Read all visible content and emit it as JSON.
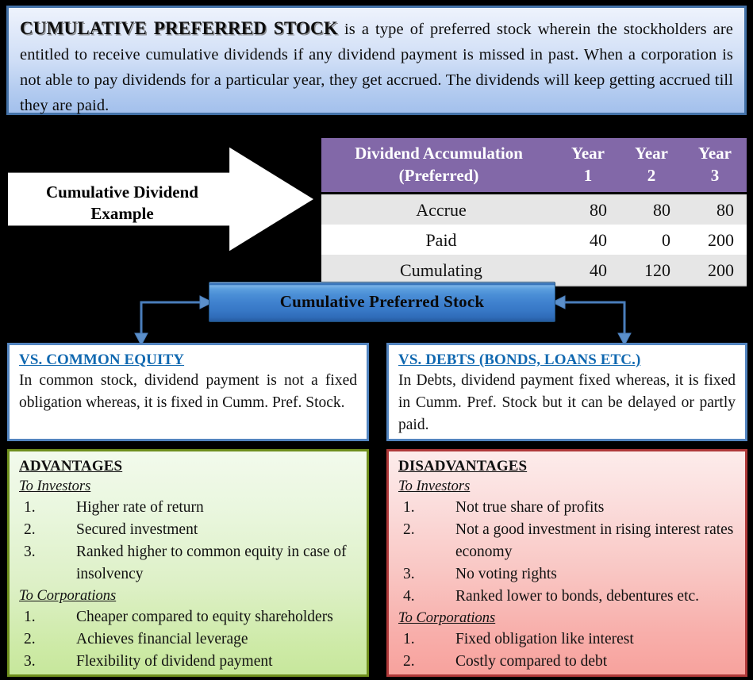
{
  "definition": {
    "lead": "CUMULATIVE PREFERRED STOCK",
    "rest": " is a type of preferred stock wherein the stockholders are entitled to receive cumulative dividends if any dividend payment is missed in past. When a corporation is not able to pay dividends for a particular year, they get accrued. The dividends will keep getting accrued till they are paid."
  },
  "example_arrow": {
    "label": "Cumulative Dividend Example"
  },
  "table": {
    "header_metric_line1": "Dividend Accumulation",
    "header_metric_line2": "(Preferred)",
    "year_word": "Year",
    "year_numbers": [
      "1",
      "2",
      "3"
    ],
    "rows": [
      {
        "metric": "Accrue",
        "values": [
          "80",
          "80",
          "80"
        ]
      },
      {
        "metric": "Paid",
        "values": [
          "40",
          "0",
          "200"
        ]
      },
      {
        "metric": "Cumulating",
        "values": [
          "40",
          "120",
          "200"
        ]
      }
    ]
  },
  "center_banner": {
    "label": "Cumulative Preferred Stock"
  },
  "compare": {
    "left": {
      "title": "VS. COMMON EQUITY",
      "body": "In common stock, dividend payment is not a fixed obligation whereas, it is fixed in Cumm. Pref. Stock."
    },
    "right": {
      "title": "VS. DEBTS (BONDS, LOANS ETC.)",
      "body": "In Debts, dividend payment fixed whereas, it is fixed in Cumm. Pref. Stock but it can be delayed or partly paid."
    }
  },
  "advantages": {
    "title": "ADVANTAGES",
    "investors_title": "To Investors",
    "investors_items": [
      {
        "idx": "1.",
        "text": "Higher rate of return"
      },
      {
        "idx": "2.",
        "text": "Secured investment"
      },
      {
        "idx": "3.",
        "text": "Ranked higher to common equity in case of insolvency"
      }
    ],
    "corporations_title": "To Corporations",
    "corporations_items": [
      {
        "idx": "1.",
        "text": "Cheaper compared to equity shareholders"
      },
      {
        "idx": "2.",
        "text": "Achieves financial leverage"
      },
      {
        "idx": "3.",
        "text": "Flexibility of dividend payment"
      }
    ]
  },
  "disadvantages": {
    "title": "DISADVANTAGES",
    "investors_title": "To Investors",
    "investors_items": [
      {
        "idx": "1.",
        "text": "Not true share of profits"
      },
      {
        "idx": "2.",
        "text": "Not a good investment in rising interest rates economy"
      },
      {
        "idx": "3.",
        "text": "No voting rights"
      },
      {
        "idx": "4.",
        "text": "Ranked lower to bonds, debentures etc."
      }
    ],
    "corporations_title": "To Corporations",
    "corporations_items": [
      {
        "idx": "1.",
        "text": "Fixed obligation like interest"
      },
      {
        "idx": "2.",
        "text": "Costly compared to debt"
      }
    ]
  },
  "colors": {
    "background": "#000000",
    "banner_border_blue": "#4472a8",
    "table_header_purple": "#8268a8",
    "center_banner_blue": "#3f81ce",
    "compare_border_blue": "#5385c0",
    "compare_title_blue": "#1068b0",
    "advantages_border_green": "#6f8f1e",
    "disadvantages_border_red": "#b03a3a",
    "connector_blue": "#4a7ebb"
  }
}
